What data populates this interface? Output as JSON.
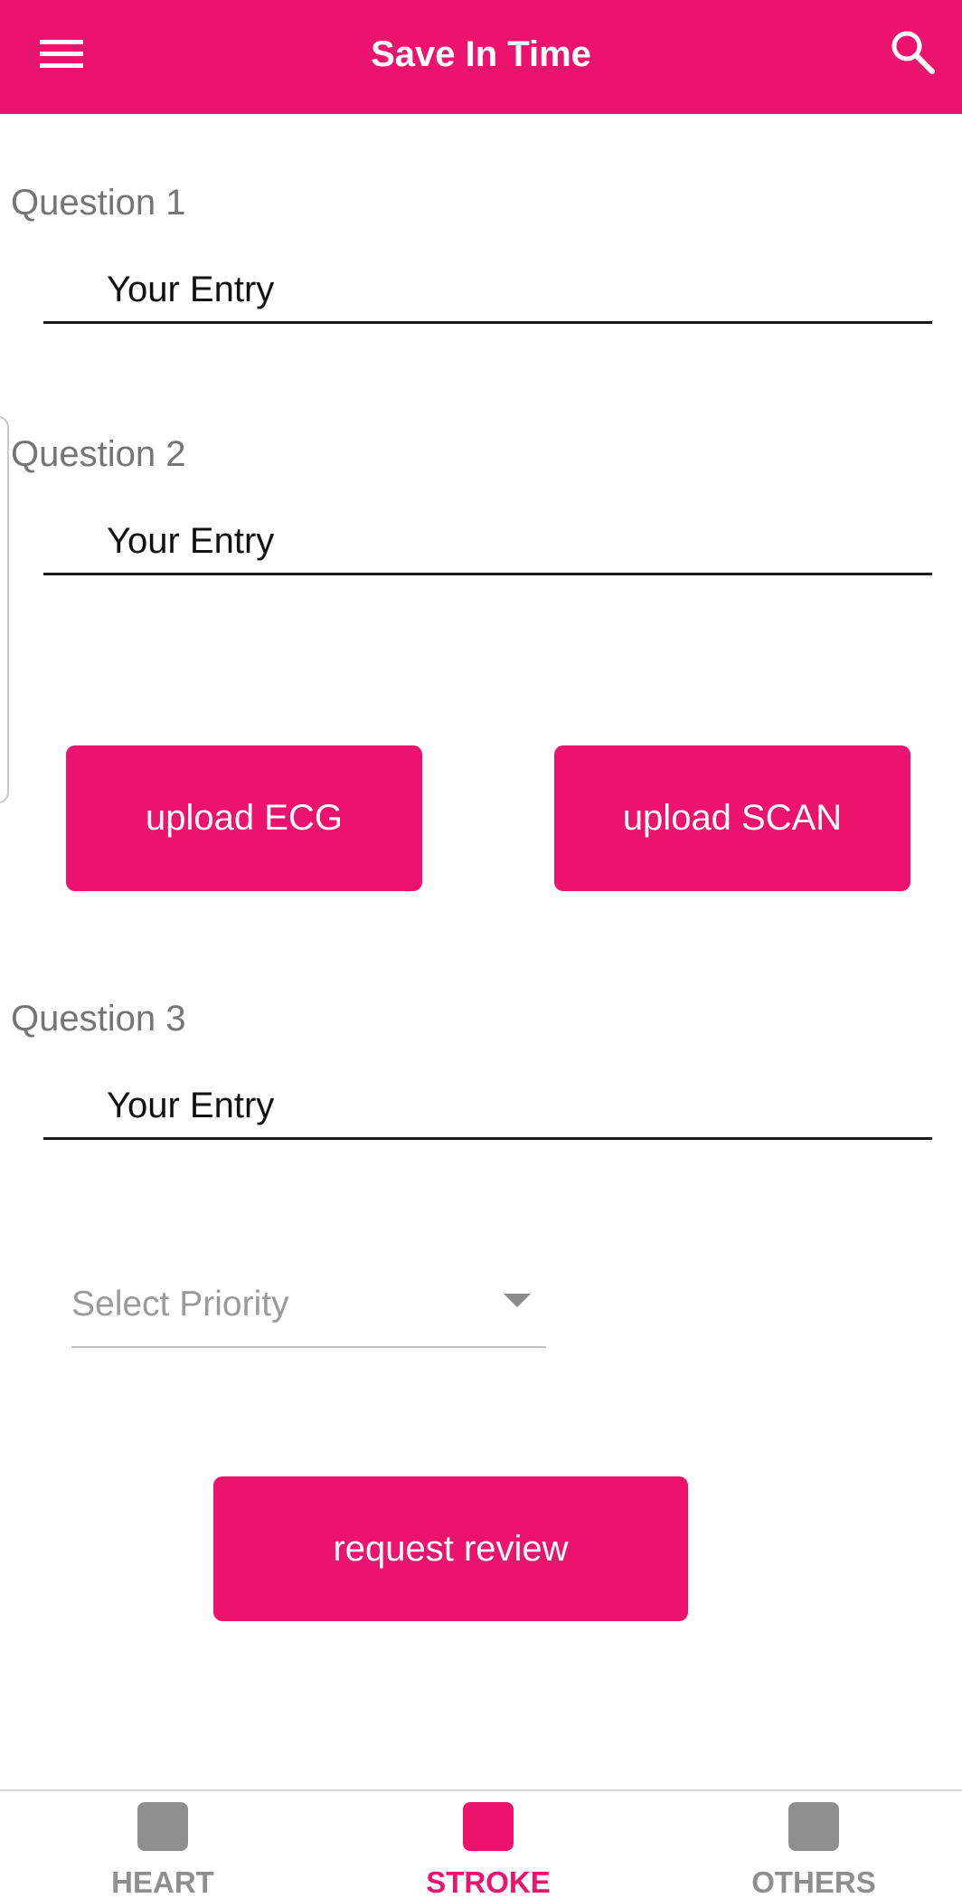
{
  "app_bar": {
    "title": "Save In Time",
    "menu_icon": "hamburger-menu-icon",
    "search_icon": "search-icon",
    "color": "#ec136f"
  },
  "questions": [
    {
      "label": "Question 1",
      "placeholder": "Your Entry"
    },
    {
      "label": "Question 2",
      "placeholder": "Your Entry"
    },
    {
      "label": "Question 3",
      "placeholder": "Your Entry"
    }
  ],
  "uploads": {
    "ecg_label": "upload ECG",
    "scan_label": "upload SCAN"
  },
  "priority_select": {
    "placeholder": "Select Priority",
    "arrow_icon": "dropdown-arrow-icon"
  },
  "review_button": {
    "label": "request review"
  },
  "bottom_nav": {
    "items": [
      {
        "label": "HEART",
        "active": false,
        "color": "#8f8f8f"
      },
      {
        "label": "STROKE",
        "active": true,
        "color": "#ec136f"
      },
      {
        "label": "OTHERS",
        "active": false,
        "color": "#8f8f8f"
      }
    ]
  }
}
